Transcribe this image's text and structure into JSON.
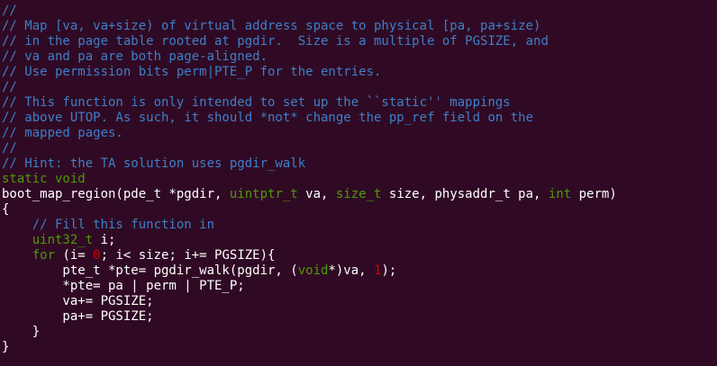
{
  "editor": {
    "lines": [
      {
        "id": "l1",
        "segments": [
          {
            "t": "//",
            "c": "comment"
          }
        ]
      },
      {
        "id": "l2",
        "segments": [
          {
            "t": "// Map [va, va+size) of virtual address space to physical [pa, pa+size)",
            "c": "comment"
          }
        ]
      },
      {
        "id": "l3",
        "segments": [
          {
            "t": "// in the page table rooted at pgdir.  Size is a multiple of PGSIZE, and",
            "c": "comment"
          }
        ]
      },
      {
        "id": "l4",
        "segments": [
          {
            "t": "// va and pa are both page-aligned.",
            "c": "comment"
          }
        ]
      },
      {
        "id": "l5",
        "segments": [
          {
            "t": "// Use permission bits perm|PTE_P for the entries.",
            "c": "comment"
          }
        ]
      },
      {
        "id": "l6",
        "segments": [
          {
            "t": "//",
            "c": "comment"
          }
        ]
      },
      {
        "id": "l7",
        "segments": [
          {
            "t": "// This function is only intended to set up the ``static'' mappings",
            "c": "comment"
          }
        ]
      },
      {
        "id": "l8",
        "segments": [
          {
            "t": "// above UTOP. As such, it should *not* change the pp_ref field on the",
            "c": "comment"
          }
        ]
      },
      {
        "id": "l9",
        "segments": [
          {
            "t": "// mapped pages.",
            "c": "comment"
          }
        ]
      },
      {
        "id": "l10",
        "segments": [
          {
            "t": "//",
            "c": "comment"
          }
        ]
      },
      {
        "id": "l11",
        "segments": [
          {
            "t": "// Hint: the TA solution uses pgdir_walk",
            "c": "comment"
          }
        ]
      },
      {
        "id": "l12",
        "segments": [
          {
            "t": "static void",
            "c": "kw-green"
          }
        ]
      },
      {
        "id": "l13",
        "segments": [
          {
            "t": "boot_map_region(pde_t *pgdir, ",
            "c": "plain"
          },
          {
            "t": "uintptr_t",
            "c": "kw-green"
          },
          {
            "t": " va, ",
            "c": "plain"
          },
          {
            "t": "size_t",
            "c": "kw-green"
          },
          {
            "t": " size, physaddr_t pa, ",
            "c": "plain"
          },
          {
            "t": "int",
            "c": "kw-green"
          },
          {
            "t": " perm)",
            "c": "plain"
          }
        ]
      },
      {
        "id": "l14",
        "segments": [
          {
            "t": "{",
            "c": "plain"
          }
        ]
      },
      {
        "id": "l15",
        "segments": [
          {
            "t": "    ",
            "c": "plain"
          },
          {
            "t": "// Fill this function in",
            "c": "comment"
          }
        ]
      },
      {
        "id": "l16",
        "segments": [
          {
            "t": "    ",
            "c": "plain"
          },
          {
            "t": "uint32_t",
            "c": "kw-green"
          },
          {
            "t": " i;",
            "c": "plain"
          }
        ]
      },
      {
        "id": "l17",
        "segments": [
          {
            "t": "    ",
            "c": "plain"
          },
          {
            "t": "for",
            "c": "kw-green"
          },
          {
            "t": " (i= ",
            "c": "plain"
          },
          {
            "t": "0",
            "c": "num"
          },
          {
            "t": "; i< size; i+= PGSIZE){",
            "c": "plain"
          }
        ]
      },
      {
        "id": "l18",
        "segments": [
          {
            "t": "        pte_t *pte= pgdir_walk(pgdir, (",
            "c": "plain"
          },
          {
            "t": "void",
            "c": "kw-green"
          },
          {
            "t": "*)va, ",
            "c": "plain"
          },
          {
            "t": "1",
            "c": "num"
          },
          {
            "t": ");",
            "c": "plain"
          }
        ]
      },
      {
        "id": "l19",
        "segments": [
          {
            "t": "        *pte= pa | perm | PTE_P;",
            "c": "plain"
          }
        ]
      },
      {
        "id": "l20",
        "segments": [
          {
            "t": "        va+= PGSIZE;",
            "c": "plain"
          }
        ]
      },
      {
        "id": "l21",
        "segments": [
          {
            "t": "        pa+= PGSIZE;",
            "c": "plain"
          }
        ]
      },
      {
        "id": "l22",
        "segments": [
          {
            "t": "    }",
            "c": "plain"
          }
        ]
      },
      {
        "id": "l23",
        "segments": [
          {
            "t": "}",
            "c": "plain"
          }
        ]
      }
    ]
  },
  "colors": {
    "background": "#300a24",
    "comment": "#3e7fc9",
    "keyword": "#4e9a06",
    "number": "#cc0000",
    "text": "#ffffff"
  }
}
